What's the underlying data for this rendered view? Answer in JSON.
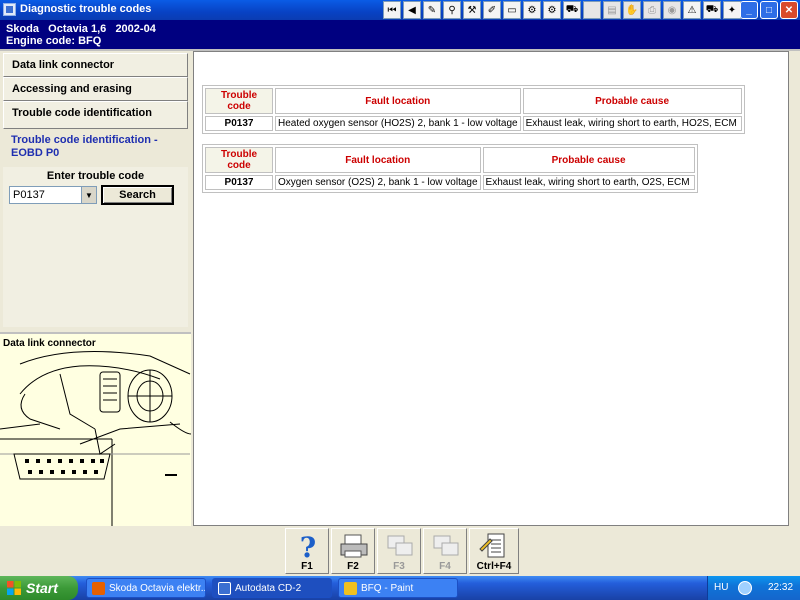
{
  "window": {
    "title": "Diagnostic trouble codes",
    "minimize": "_",
    "maximize": "□",
    "close": "✕"
  },
  "toolbar_icons": [
    "first-page-icon",
    "prev-icon",
    "note-icon",
    "search-icon",
    "tools-icon",
    "pen-icon",
    "battery-icon",
    "wrench-icon",
    "engine-icon",
    "car-icon",
    "blank-icon",
    "document-icon",
    "hand-icon",
    "printer-icon",
    "camera-icon",
    "warning-icon",
    "car-side-icon",
    "tool2-icon"
  ],
  "vehicle": {
    "line1": "Skoda   Octavia 1,6   2002-04",
    "line2": "Engine code: BFQ"
  },
  "nav": {
    "items": [
      "Data link connector",
      "Accessing and erasing",
      "Trouble code identification"
    ],
    "active": "Trouble code identification - EOBD P0"
  },
  "search": {
    "label": "Enter trouble code",
    "value": "P0137",
    "button": "Search"
  },
  "diagram": {
    "title": "Data link connector"
  },
  "tables": [
    {
      "headers": [
        "Trouble code",
        "Fault location",
        "Probable cause"
      ],
      "rows": [
        [
          "P0137",
          "Heated oxygen sensor (HO2S) 2, bank 1 - low voltage",
          "Exhaust leak, wiring short to earth, HO2S, ECM"
        ]
      ]
    },
    {
      "headers": [
        "Trouble code",
        "Fault location",
        "Probable cause"
      ],
      "rows": [
        [
          "P0137",
          "Oxygen sensor (O2S) 2, bank 1 - low voltage",
          "Exhaust leak, wiring short to earth, O2S, ECM"
        ]
      ]
    }
  ],
  "fkeys": [
    {
      "label": "F1",
      "icon": "help-icon",
      "enabled": true
    },
    {
      "label": "F2",
      "icon": "printer-icon",
      "enabled": true
    },
    {
      "label": "F3",
      "icon": "copy-icon",
      "enabled": false
    },
    {
      "label": "F4",
      "icon": "copy-icon",
      "enabled": false
    },
    {
      "label": "Ctrl+F4",
      "icon": "notes-icon",
      "enabled": true
    }
  ],
  "taskbar": {
    "start": "Start",
    "tasks": [
      "Skoda Octavia elektr...",
      "Autodata CD-2",
      "BFQ - Paint"
    ],
    "lang": "HU",
    "clock": "22:32"
  }
}
